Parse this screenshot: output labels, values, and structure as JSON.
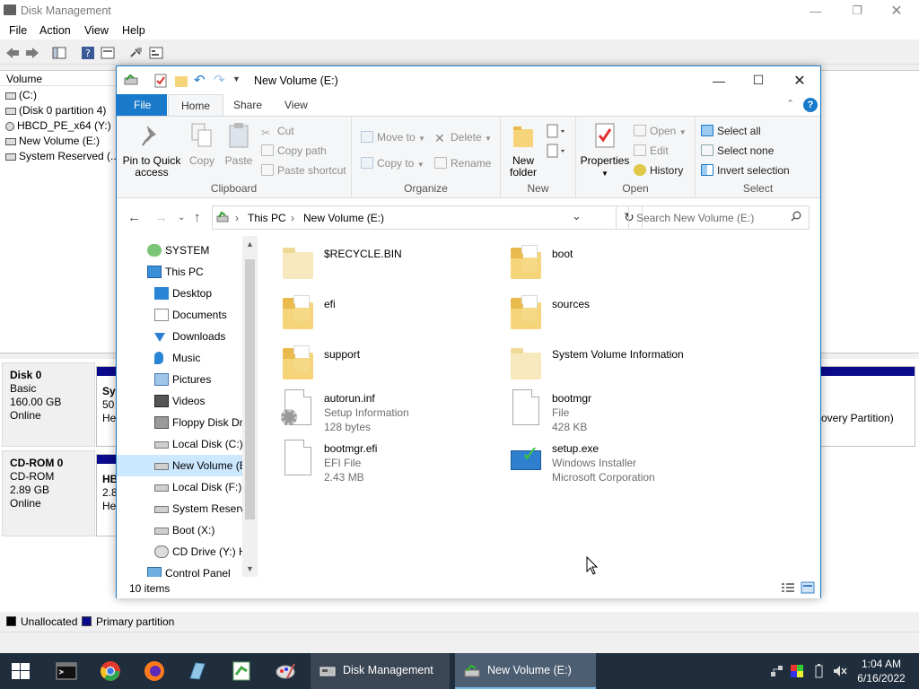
{
  "dm": {
    "title": "Disk Management",
    "menu": [
      "File",
      "Action",
      "View",
      "Help"
    ],
    "list_header": "Volume",
    "volumes": [
      "(C:)",
      "(Disk 0 partition 4)",
      "HBCD_PE_x64 (Y:)",
      "New Volume (E:)",
      "System Reserved (..."
    ],
    "disk0": {
      "name": "Disk 0",
      "type": "Basic",
      "size": "160.00 GB",
      "status": "Online"
    },
    "cdrom": {
      "name": "CD-ROM 0",
      "type": "CD-ROM",
      "size": "2.89 GB",
      "status": "Online"
    },
    "disk0_part_text": {
      "l1": "Sys",
      "l2": "50",
      "l3": "He"
    },
    "cdrom_part_text": {
      "l1": "HB",
      "l2": "2.8",
      "l3": "He"
    },
    "right_part_text": "overy Partition)",
    "legend": {
      "unallocated": "Unallocated",
      "primary": "Primary partition"
    }
  },
  "explorer": {
    "title": "New Volume (E:)",
    "tabs": {
      "file": "File",
      "home": "Home",
      "share": "Share",
      "view": "View"
    },
    "ribbon": {
      "clipboard": {
        "label": "Clipboard",
        "pin": "Pin to Quick\naccess",
        "copy": "Copy",
        "paste": "Paste",
        "cut": "Cut",
        "copy_path": "Copy path",
        "paste_shortcut": "Paste shortcut"
      },
      "organize": {
        "label": "Organize",
        "move_to": "Move to",
        "copy_to": "Copy to",
        "delete": "Delete",
        "rename": "Rename"
      },
      "new": {
        "label": "New",
        "new_folder": "New\nfolder"
      },
      "open": {
        "label": "Open",
        "properties": "Properties",
        "open": "Open",
        "edit": "Edit",
        "history": "History"
      },
      "select": {
        "label": "Select",
        "select_all": "Select all",
        "select_none": "Select none",
        "invert": "Invert selection"
      }
    },
    "address": {
      "this_pc": "This PC",
      "volume": "New Volume (E:)"
    },
    "search_placeholder": "Search New Volume (E:)",
    "nav": [
      {
        "label": "SYSTEM",
        "icon": "user-icon",
        "indent": 0
      },
      {
        "label": "This PC",
        "icon": "computer-icon",
        "indent": 0
      },
      {
        "label": "Desktop",
        "icon": "desktop-icon",
        "indent": 1
      },
      {
        "label": "Documents",
        "icon": "documents-icon",
        "indent": 1
      },
      {
        "label": "Downloads",
        "icon": "downloads-icon",
        "indent": 1
      },
      {
        "label": "Music",
        "icon": "music-icon",
        "indent": 1
      },
      {
        "label": "Pictures",
        "icon": "pictures-icon",
        "indent": 1
      },
      {
        "label": "Videos",
        "icon": "videos-icon",
        "indent": 1
      },
      {
        "label": "Floppy Disk Dri",
        "icon": "floppy-icon",
        "indent": 1
      },
      {
        "label": "Local Disk (C:)",
        "icon": "drive-icon",
        "indent": 1
      },
      {
        "label": "New Volume (E",
        "icon": "drive-icon",
        "indent": 1,
        "selected": true
      },
      {
        "label": "Local Disk (F:)",
        "icon": "drive-icon",
        "indent": 1
      },
      {
        "label": "System Reserve",
        "icon": "drive-icon",
        "indent": 1
      },
      {
        "label": "Boot (X:)",
        "icon": "drive-icon",
        "indent": 1
      },
      {
        "label": "CD Drive (Y:) H",
        "icon": "cd-drive-icon",
        "indent": 1
      },
      {
        "label": "Control Panel",
        "icon": "control-panel-icon",
        "indent": 0
      }
    ],
    "files": [
      {
        "name": "$RECYCLE.BIN",
        "kind": "folder-faded"
      },
      {
        "name": "boot",
        "kind": "folder-paper"
      },
      {
        "name": "efi",
        "kind": "folder-paper"
      },
      {
        "name": "sources",
        "kind": "folder-paper"
      },
      {
        "name": "support",
        "kind": "folder-paper"
      },
      {
        "name": "System Volume Information",
        "kind": "folder-faded"
      },
      {
        "name": "autorun.inf",
        "type": "Setup Information",
        "size": "128 bytes",
        "kind": "inf"
      },
      {
        "name": "bootmgr",
        "type": "File",
        "size": "428 KB",
        "kind": "doc"
      },
      {
        "name": "bootmgr.efi",
        "type": "EFI File",
        "size": "2.43 MB",
        "kind": "doc"
      },
      {
        "name": "setup.exe",
        "type": "Windows Installer",
        "size": "Microsoft Corporation",
        "kind": "exe"
      }
    ],
    "status": "10 items"
  },
  "taskbar": {
    "task1": "Disk Management",
    "task2": "New Volume (E:)",
    "time": "1:04 AM",
    "date": "6/16/2022"
  },
  "colors": {
    "accent": "#1979ca",
    "taskbar": "#1f2d3d",
    "primary_partition": "#0a0a8c",
    "selection": "#cce8ff"
  }
}
